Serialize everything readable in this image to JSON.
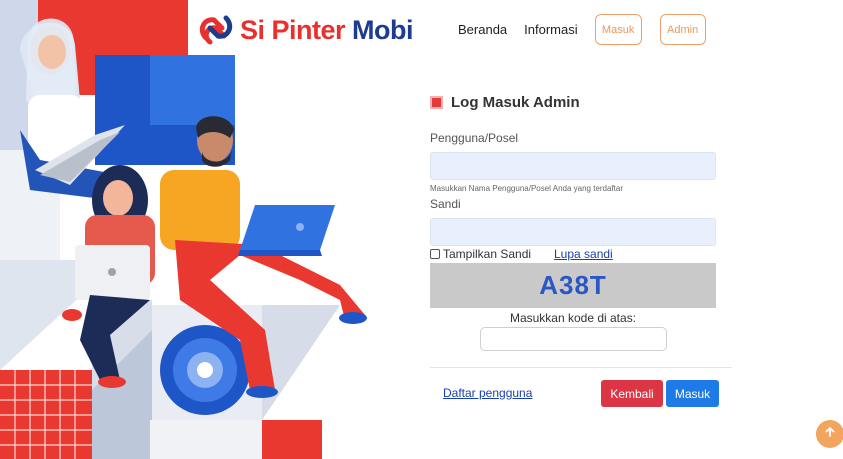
{
  "brand": {
    "name_part1": "Si Pinter",
    "name_part2": "Mobi"
  },
  "nav": {
    "home": "Beranda",
    "info": "Informasi",
    "login": "Masuk",
    "admin": "Admin"
  },
  "form": {
    "title": "Log Masuk Admin",
    "username_label": "Pengguna/Posel",
    "username_value": "",
    "username_hint": "Masukkan Nama Pengguna/Posel Anda yang terdaftar",
    "password_label": "Sandi",
    "password_value": "",
    "show_password_label": "Tampilkan Sandi",
    "show_password_checked": false,
    "forgot_password": "Lupa sandi",
    "captcha_code": "A38T",
    "captcha_prompt": "Masukkan kode di atas:",
    "captcha_value": "",
    "register_link": "Daftar pengguna",
    "back_button": "Kembali",
    "submit_button": "Masuk"
  },
  "icons": {
    "scroll_top": "arrow-up-icon",
    "title_marker": "square-icon",
    "logo": "logo-icon"
  },
  "colors": {
    "brand_red": "#e8312f",
    "brand_navy": "#1d3b8f",
    "nav_accent": "#f0965a",
    "back": "#dc3545",
    "submit": "#1e7ae6",
    "field_bg": "#e8f0fe",
    "captcha_bg": "#c9c9c9",
    "captcha_text": "#2a56c6"
  }
}
